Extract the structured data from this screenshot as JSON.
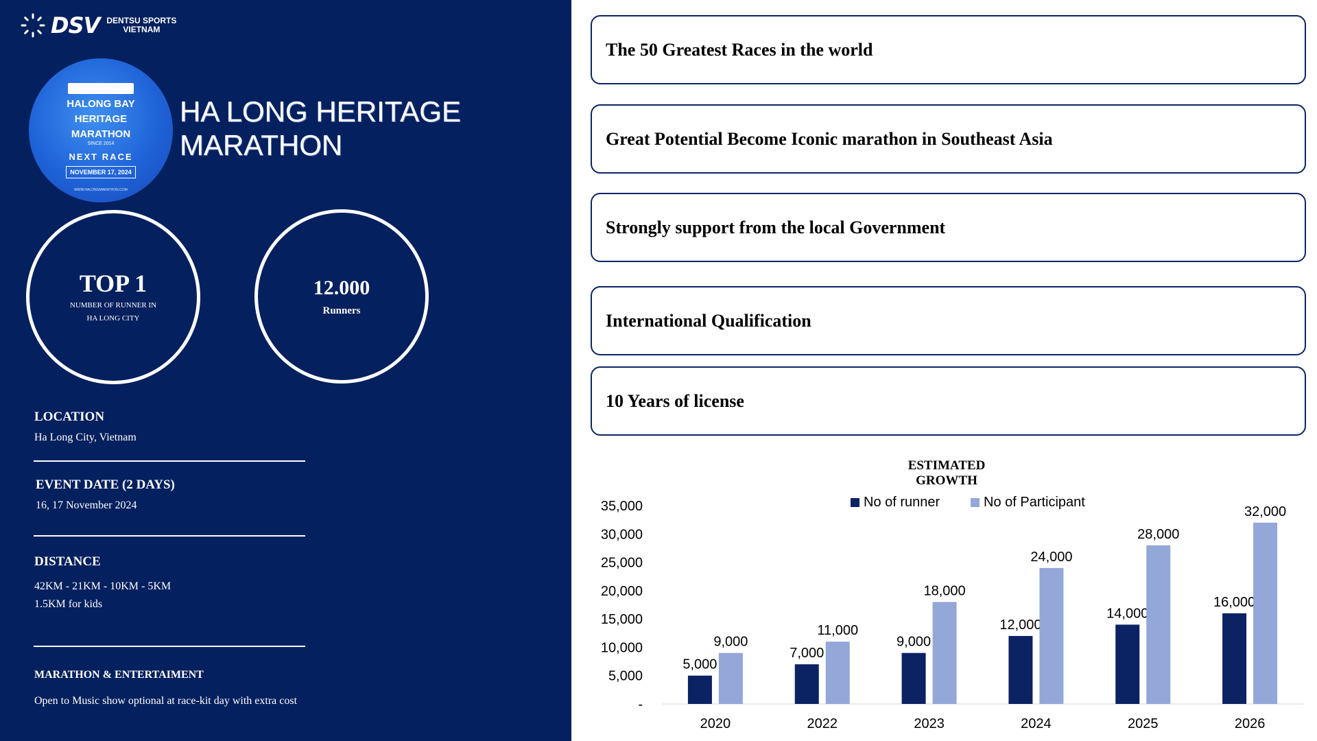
{
  "brand": {
    "logo_text": "DSV",
    "logo_sub_line1": "DENTSU SPORTS",
    "logo_sub_line2": "VIETNAM"
  },
  "badge": {
    "line1": "HALONG BAY",
    "line2": "HERITAGE",
    "line3": "MARATHON",
    "since": "SINCE 2014",
    "next_race": "NEXT RACE",
    "date": "NOVEMBER 17, 2024",
    "url": "WWW.HALONGMARATHON.COM"
  },
  "title": "HA LONG HERITAGE MARATHON",
  "stats": [
    {
      "value": "TOP 1",
      "label": "NUMBER OF RUNNER IN HA LONG CITY"
    },
    {
      "value": "12.000",
      "label": "Runners"
    }
  ],
  "info": [
    {
      "heading": "LOCATION",
      "text": "Ha Long City, Vietnam"
    },
    {
      "heading": "EVENT DATE (2 DAYS)",
      "text": "16, 17  November 2024"
    },
    {
      "heading": "DISTANCE",
      "text": "42KM  -  21KM  -  10KM  -  5KM",
      "text2": "1.5KM for kids"
    },
    {
      "heading": "MARATHON & ENTERTAIMENT",
      "text": "Open to Music show optional at race-kit day with extra cost"
    }
  ],
  "highlights": [
    "The 50 Greatest Races in the world",
    "Great Potential Become Iconic marathon in Southeast Asia",
    "Strongly support from the local Government",
    "International Qualification",
    "10 Years of license"
  ],
  "colors": {
    "navy": "#05205e",
    "runner": "#0b2263",
    "participant": "#93a7d8"
  },
  "chart_data": {
    "type": "bar",
    "title": "ESTIMATED GROWTH",
    "categories": [
      "2020",
      "2022",
      "2023",
      "2024",
      "2025",
      "2026"
    ],
    "series": [
      {
        "name": "No of runner",
        "values": [
          5000,
          7000,
          9000,
          12000,
          14000,
          16000
        ]
      },
      {
        "name": "No of Participant",
        "values": [
          9000,
          11000,
          18000,
          24000,
          28000,
          32000
        ]
      }
    ],
    "data_labels": [
      [
        "5,000",
        "7,000",
        "9,000",
        "12,000",
        "14,000",
        "16,000"
      ],
      [
        "9,000",
        "11,000",
        "18,000",
        "24,000",
        "28,000",
        "32,000"
      ]
    ],
    "ylim": [
      0,
      35000
    ],
    "yticks": [
      0,
      5000,
      10000,
      15000,
      20000,
      25000,
      30000,
      35000
    ],
    "ytick_labels": [
      "-",
      "5,000",
      "10,000",
      "15,000",
      "20,000",
      "25,000",
      "30,000",
      "35,000"
    ],
    "legend_position": "top-center",
    "grid": false
  }
}
